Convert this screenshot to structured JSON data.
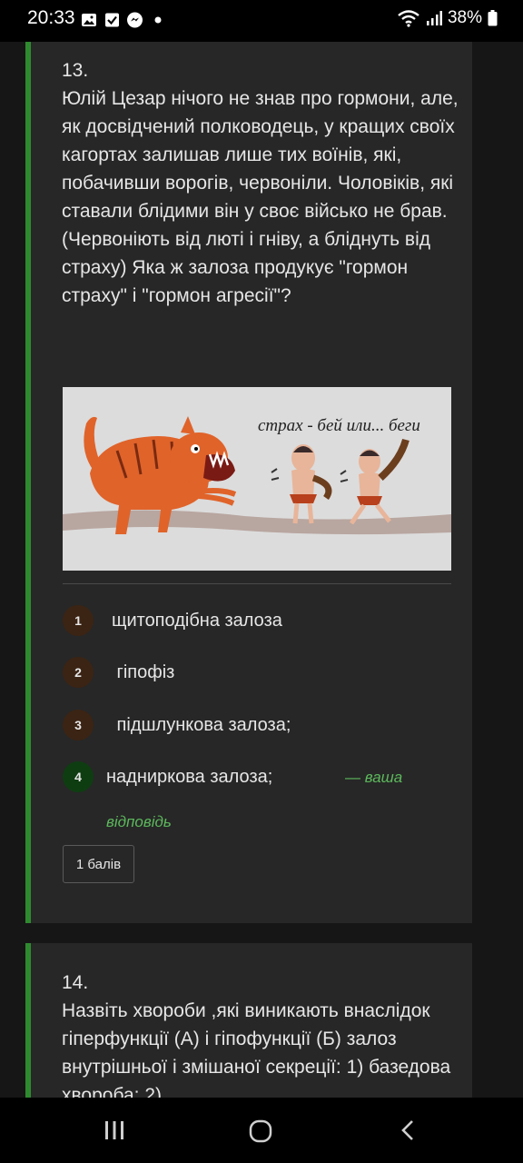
{
  "status_bar": {
    "time": "20:33",
    "battery": "38%",
    "icons": [
      "image-icon",
      "check-icon",
      "messenger-icon",
      "dot-icon",
      "wifi-icon",
      "signal-icon",
      "battery-icon"
    ]
  },
  "question13": {
    "number": "13.",
    "text": "Юлій Цезар нічого не знав про гормони, але, як досвідчений полководець, у кращих своїх кагортах залишав лише тих воїнів, які, побачивши ворогів, червоніли. Чоловіків, які ставали блідими він у своє військо не брав. (Червоніють від люті і гніву, а бліднуть від страху) Яка ж залоза продукує \"гормон страху\" і \"гормон агресії\"?",
    "image_caption": "страх - бей или... беги",
    "options": [
      {
        "num": "1",
        "label": "щитоподібна залоза"
      },
      {
        "num": "2",
        "label": " гіпофіз"
      },
      {
        "num": "3",
        "label": " підшлункова залоза;"
      },
      {
        "num": "4",
        "label": "надниркова залоза;"
      }
    ],
    "your_answer_part1": "— ваша",
    "your_answer_part2": "відповідь",
    "points": "1 балів"
  },
  "question14": {
    "number": "14.",
    "text": " Назвіть хвороби ,які виникають внаслідок гіперфункції (А) і гіпофункції (Б) залоз внутрішньої і змішаної секреції: 1) базедова хвороба; 2)"
  },
  "colors": {
    "accent_green": "#2f8a2f",
    "answer_green": "#5cb85c",
    "card_bg": "#272727",
    "page_bg": "#161616",
    "badge_brown": "#3b2414",
    "badge_selected": "#0f3d12"
  }
}
